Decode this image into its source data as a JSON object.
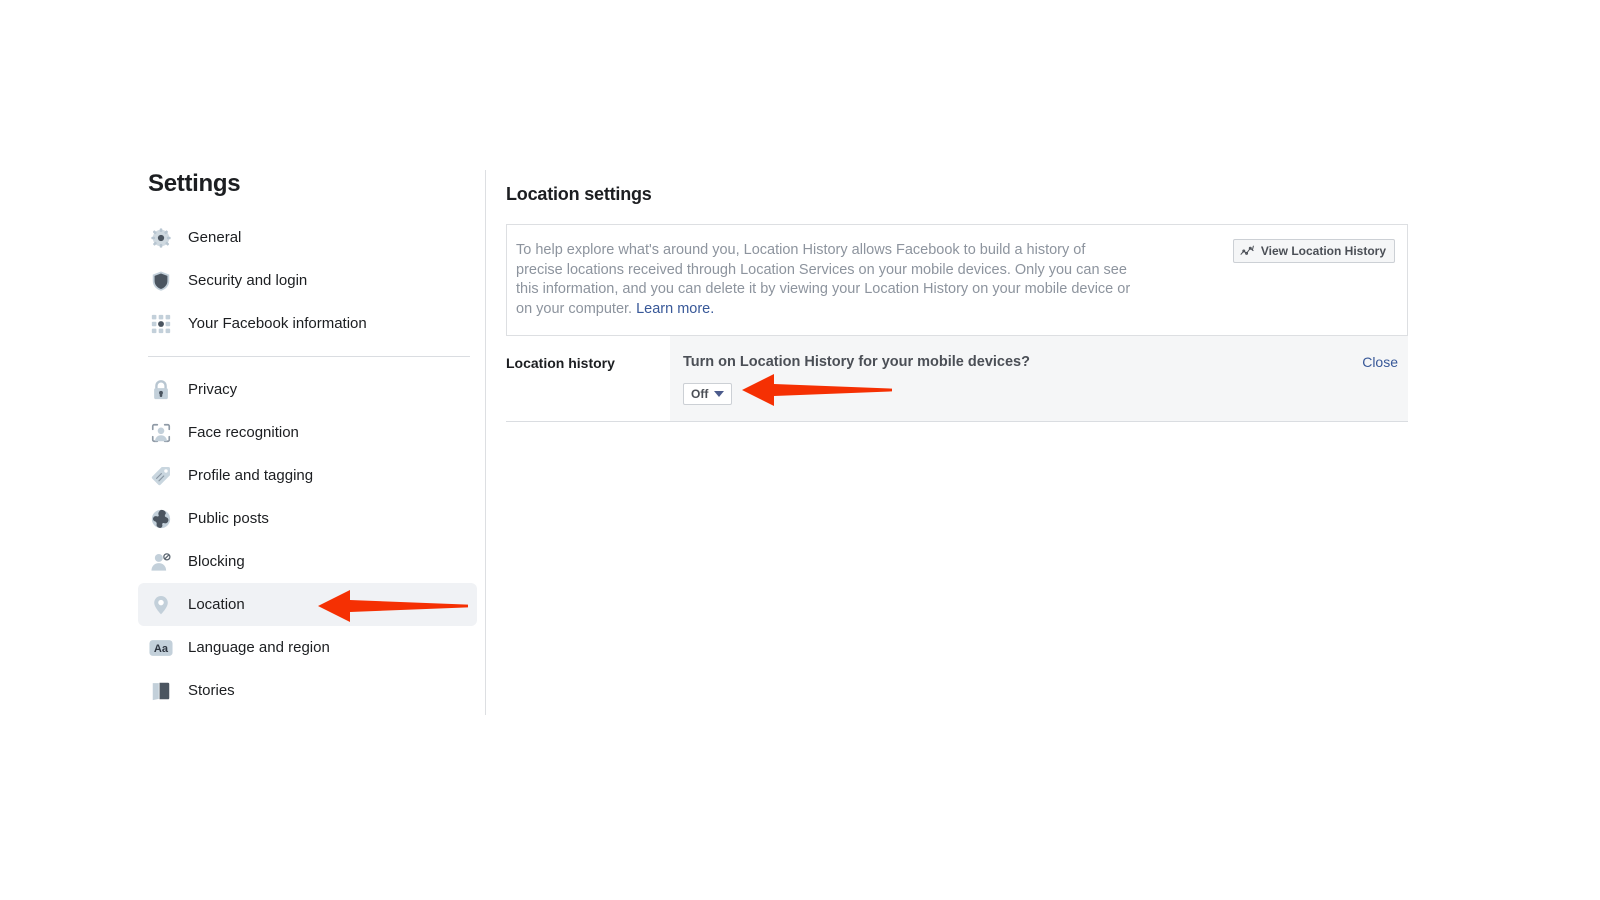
{
  "sidebar": {
    "title": "Settings",
    "groups": [
      {
        "items": [
          {
            "label": "General",
            "icon": "gear-icon",
            "active": false
          },
          {
            "label": "Security and login",
            "icon": "shield-icon",
            "active": false
          },
          {
            "label": "Your Facebook information",
            "icon": "grid-dots-icon",
            "active": false
          }
        ]
      },
      {
        "items": [
          {
            "label": "Privacy",
            "icon": "lock-icon",
            "active": false
          },
          {
            "label": "Face recognition",
            "icon": "face-scan-icon",
            "active": false
          },
          {
            "label": "Profile and tagging",
            "icon": "tag-icon",
            "active": false
          },
          {
            "label": "Public posts",
            "icon": "globe-icon",
            "active": false
          },
          {
            "label": "Blocking",
            "icon": "person-block-icon",
            "active": false
          },
          {
            "label": "Location",
            "icon": "map-pin-icon",
            "active": true
          },
          {
            "label": "Language and region",
            "icon": "aa-text-icon",
            "active": false
          },
          {
            "label": "Stories",
            "icon": "book-icon",
            "active": false
          }
        ]
      }
    ]
  },
  "main": {
    "title": "Location settings",
    "info": {
      "text": "To help explore what's around you, Location History allows Facebook to build a history of precise locations received through Location Services on your mobile devices. Only you can see this information, and you can delete it by viewing your Location History on your mobile device or on your computer. ",
      "link_label": "Learn more.",
      "button_label": "View Location History",
      "button_icon": "activity-chart-icon"
    },
    "history_row": {
      "label": "Location history",
      "question": "Turn on Location History for your mobile devices?",
      "select_value": "Off",
      "select_icon": "chevron-down-icon",
      "close_label": "Close"
    }
  },
  "annotations": {
    "arrow_color": "#f53003",
    "arrows": [
      {
        "name": "arrow-pointing-to-location-nav",
        "direction": "left"
      },
      {
        "name": "arrow-pointing-to-off-dropdown",
        "direction": "left"
      }
    ]
  }
}
